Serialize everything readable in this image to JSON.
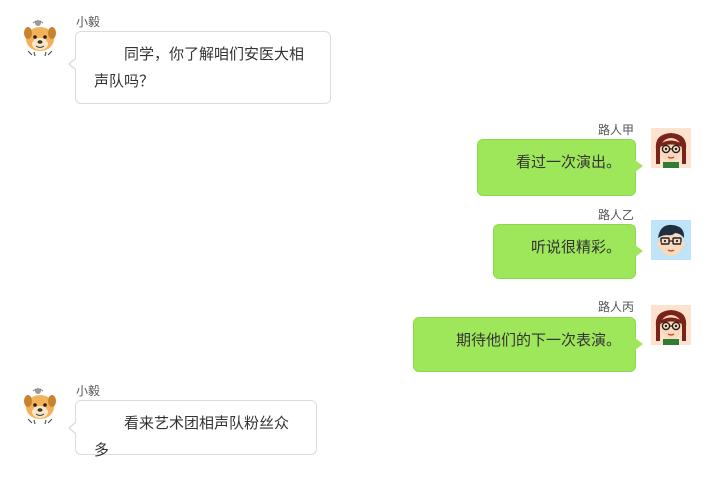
{
  "messages": [
    {
      "sender": "小毅",
      "text": "同学，你了解咱们安医大相声队吗？",
      "side": "left",
      "avatar": "dog-avatar-icon"
    },
    {
      "sender": "路人甲",
      "text": "看过一次演出。",
      "side": "right",
      "avatar": "girl-glasses-avatar-icon"
    },
    {
      "sender": "路人乙",
      "text": "听说很精彩。",
      "side": "right",
      "avatar": "boy-glasses-avatar-icon"
    },
    {
      "sender": "路人丙",
      "text": "期待他们的下一次表演。",
      "side": "right",
      "avatar": "girl-glasses-avatar-icon"
    },
    {
      "sender": "小毅",
      "text": "看来艺术团相声队粉丝众多",
      "side": "left",
      "avatar": "dog-avatar-icon"
    }
  ],
  "colors": {
    "right_bubble": "#9ee75a",
    "left_bubble": "#ffffff",
    "left_border": "#dcdcdc"
  }
}
